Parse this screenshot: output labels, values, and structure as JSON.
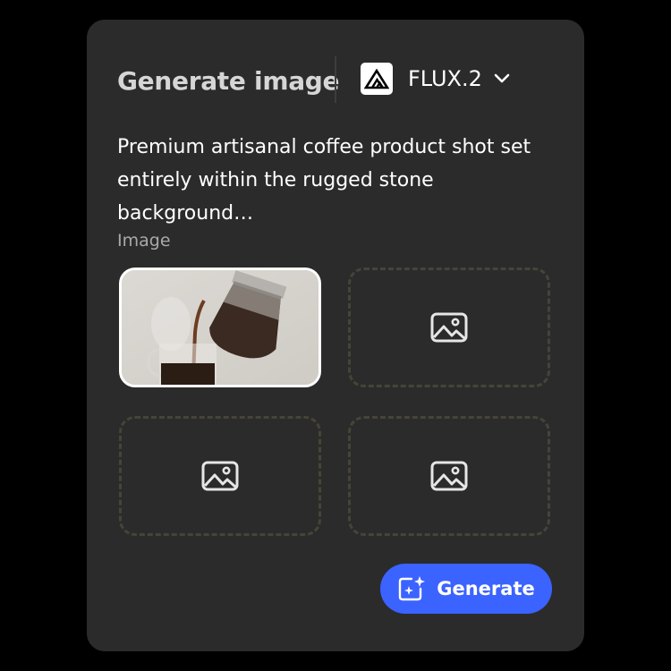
{
  "panel": {
    "title": "Generate image",
    "model": {
      "name": "FLUX.2",
      "logo_icon": "flux-logo-icon",
      "dropdown_icon": "chevron-down-icon"
    },
    "prompt": "Premium artisanal coffee product shot set entirely within the rugged stone background…",
    "image_section": {
      "label": "Image",
      "slots": [
        {
          "state": "filled",
          "content": "coffee-pour-thumbnail"
        },
        {
          "state": "empty",
          "icon": "image-placeholder-icon"
        },
        {
          "state": "empty",
          "icon": "image-placeholder-icon"
        },
        {
          "state": "empty",
          "icon": "image-placeholder-icon"
        }
      ]
    },
    "generate_button": {
      "label": "Generate",
      "icon": "sparkle-image-icon"
    }
  },
  "colors": {
    "background": "#000000",
    "panel": "#2b2b2b",
    "accent": "#3b63ff",
    "title_text": "#d6d6d6",
    "secondary_text": "#a9a9a9",
    "dashed_border": "#464439"
  }
}
